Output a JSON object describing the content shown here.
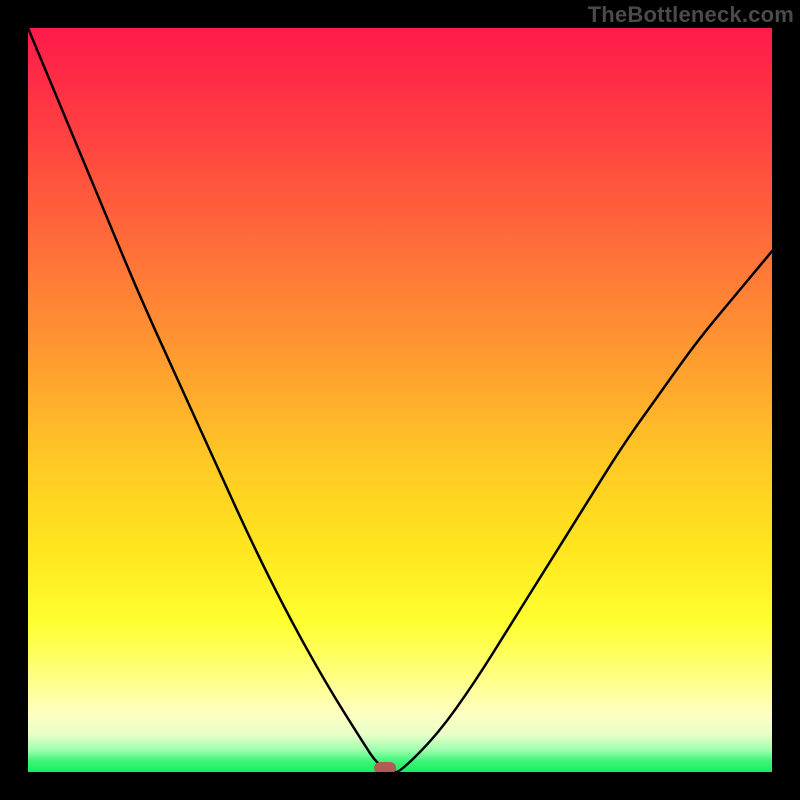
{
  "watermark": "TheBottleneck.com",
  "chart_data": {
    "type": "line",
    "title": "",
    "xlabel": "",
    "ylabel": "",
    "xlim": [
      0,
      100
    ],
    "ylim": [
      0,
      100
    ],
    "grid": false,
    "legend": false,
    "series": [
      {
        "name": "bottleneck-curve",
        "x": [
          0,
          5,
          10,
          15,
          20,
          25,
          30,
          35,
          40,
          45,
          47,
          49,
          50,
          55,
          60,
          65,
          70,
          75,
          80,
          85,
          90,
          95,
          100
        ],
        "values": [
          100,
          88,
          76,
          64,
          53,
          42,
          31,
          21,
          12,
          4,
          1,
          0,
          0,
          5,
          12,
          20,
          28,
          36,
          44,
          51,
          58,
          64,
          70
        ]
      }
    ],
    "bottleneck_point": {
      "x": 48,
      "y": 0
    },
    "gradient_stops": [
      {
        "pct": 0,
        "color": "#ff1a4b"
      },
      {
        "pct": 12,
        "color": "#ff3a42"
      },
      {
        "pct": 28,
        "color": "#ff6a3a"
      },
      {
        "pct": 44,
        "color": "#ff9a30"
      },
      {
        "pct": 58,
        "color": "#ffc825"
      },
      {
        "pct": 70,
        "color": "#ffe61e"
      },
      {
        "pct": 80,
        "color": "#ffff30"
      },
      {
        "pct": 87,
        "color": "#ffff80"
      },
      {
        "pct": 92,
        "color": "#ffffc0"
      },
      {
        "pct": 95,
        "color": "#e8ffc8"
      },
      {
        "pct": 97,
        "color": "#a0ffb0"
      },
      {
        "pct": 98.5,
        "color": "#40f57a"
      },
      {
        "pct": 100,
        "color": "#13ef5d"
      }
    ]
  }
}
